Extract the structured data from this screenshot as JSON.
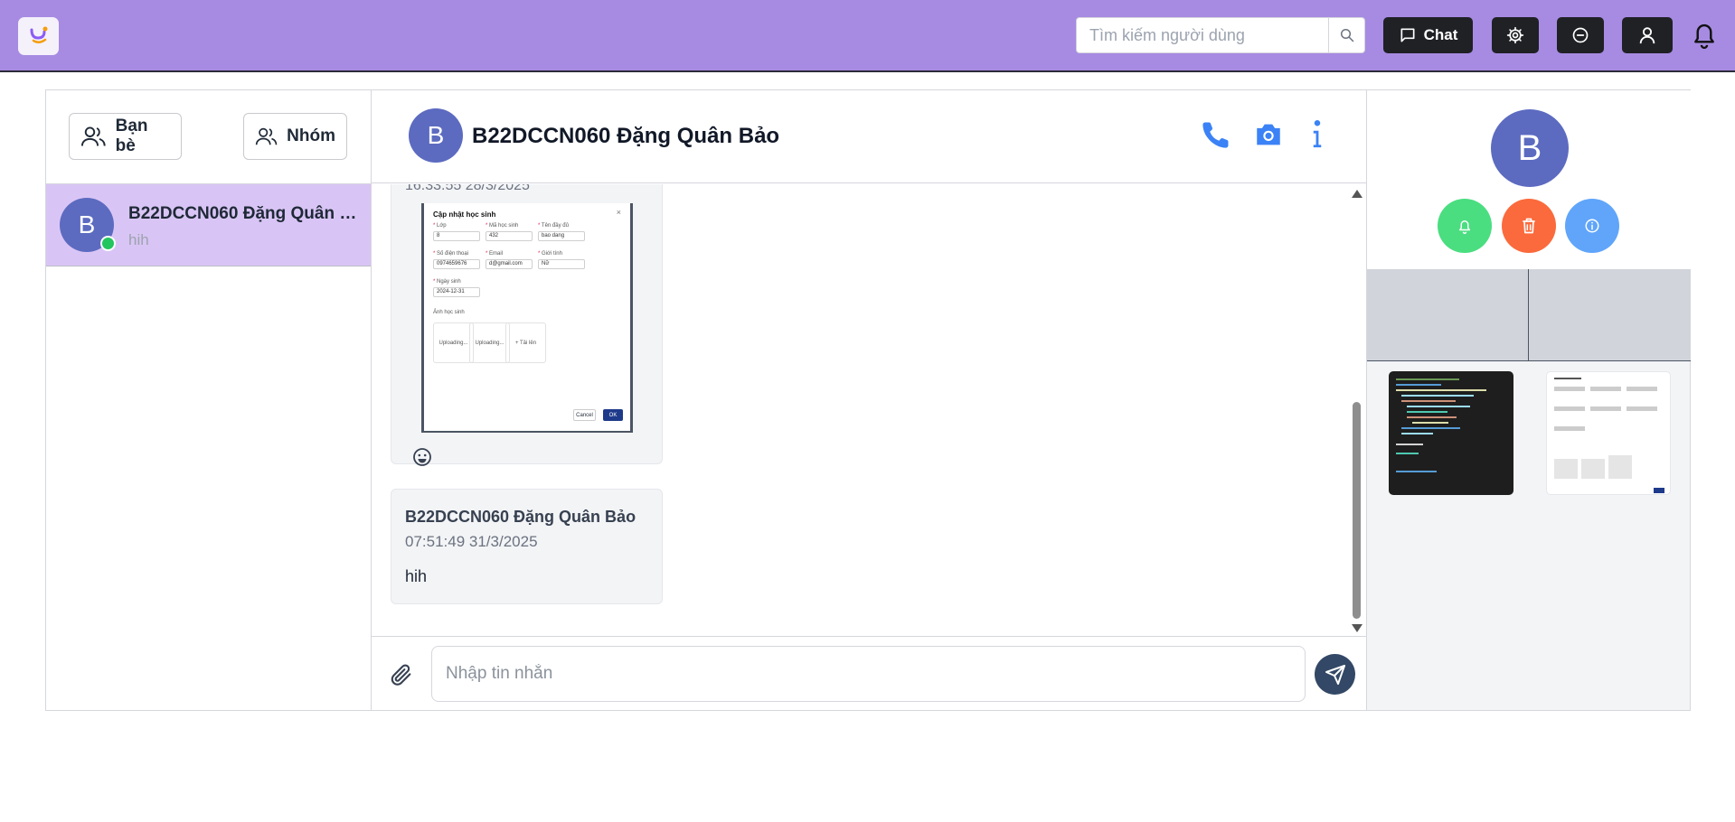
{
  "header": {
    "search_placeholder": "Tìm kiếm người dùng",
    "chat_label": "Chat"
  },
  "sidebar": {
    "friends_label": "Bạn bè",
    "groups_label": "Nhóm",
    "conversations": [
      {
        "avatar_letter": "B",
        "name": "B22DCCN060 Đặng Quân Bảo",
        "last_message": "hih",
        "online": true
      }
    ]
  },
  "chat": {
    "avatar_letter": "B",
    "title": "B22DCCN060 Đặng Quân Bảo",
    "messages": [
      {
        "time": "16:33:55 28/3/2025",
        "attachment": {
          "title": "Cập nhật học sinh",
          "fields": {
            "class_label": "Lớp",
            "class_value": "8",
            "student_id_label": "Mã học sinh",
            "student_id_value": "432",
            "fullname_label": "Tên đầy đủ",
            "fullname_value": "bao dang",
            "phone_label": "Số điện thoại",
            "phone_value": "0974659676",
            "email_label": "Email",
            "email_value": "d@gmail.com",
            "gender_label": "Giới tính",
            "gender_value": "Nữ",
            "dob_label": "Ngày sinh",
            "dob_value": "2024-12-31",
            "photo_label": "Ảnh học sinh"
          },
          "upload_1": "Uploading...",
          "upload_2": "Uploading...",
          "upload_add": "+ Tải lên",
          "cancel": "Cancel",
          "ok": "OK"
        }
      },
      {
        "sender": "B22DCCN060 Đặng Quân Bảo",
        "time": "07:51:49 31/3/2025",
        "text": "hih"
      }
    ],
    "input_placeholder": "Nhập tin nhắn"
  },
  "info_panel": {
    "avatar_letter": "B"
  },
  "colors": {
    "header_bg": "#a78be2",
    "dark_button": "#1f2125",
    "selected_conversation": "#d9c5f5",
    "avatar": "#5c6bc0",
    "online": "#22c55e",
    "accent_blue": "#3b82f6",
    "notify_green": "#4ade80",
    "delete_orange": "#fb6a3c",
    "info_blue": "#60a5fa",
    "send_button": "#334866"
  }
}
